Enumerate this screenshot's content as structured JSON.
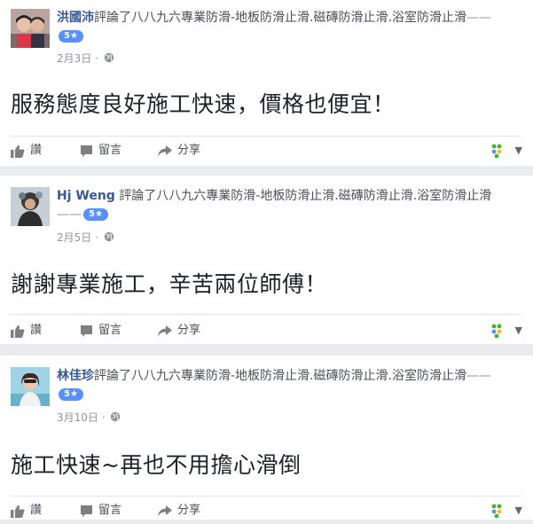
{
  "posts": [
    {
      "author": "洪國沛",
      "action": "評論了八八九六專業防滑-地板防滑止滑.磁磚防滑止滑.浴室防滑止滑",
      "rating": "5★",
      "date": "2月3日",
      "separator": "·",
      "text": "服務態度良好施工快速，價格也便宜！"
    },
    {
      "author": "Hj Weng",
      "action": "評論了八八九六專業防滑-地板防滑止滑.磁磚防滑止滑.浴室防滑止滑",
      "rating": "5★",
      "date": "2月5日",
      "separator": "·",
      "text": "謝謝專業施工，辛苦兩位師傅！"
    },
    {
      "author": "林佳珍",
      "action": "評論了八八九六專業防滑-地板防滑止滑.磁磚防滑止滑.浴室防滑止滑",
      "rating": "5★",
      "date": "3月10日",
      "separator": "·",
      "text": "施工快速~再也不用擔心滑倒"
    }
  ],
  "actions": {
    "like": "讚",
    "comment": "留言",
    "share": "分享"
  },
  "icons": [
    "thumbs-up-icon",
    "comment-icon",
    "share-arrow-icon",
    "globe-icon",
    "reactions-icon",
    "chevron-down-icon"
  ],
  "colors": {
    "name": "#365899",
    "badge": "#5890ff",
    "text": "#1d2129",
    "muted": "#90949c",
    "bg": "#e9ebee"
  }
}
